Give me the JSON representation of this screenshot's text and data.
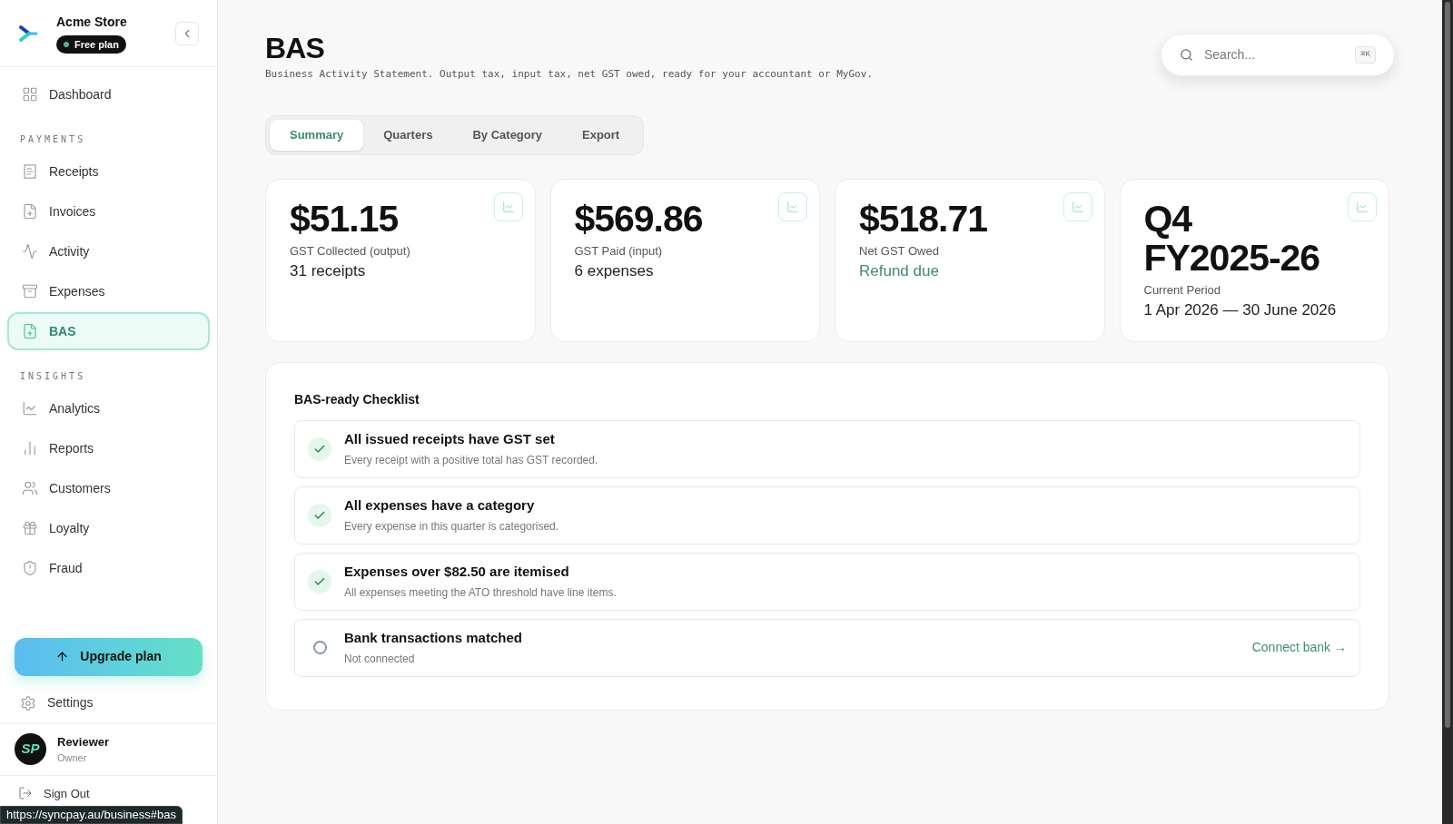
{
  "sidebar": {
    "store_name": "Acme Store",
    "plan_badge": "Free plan",
    "nav": [
      {
        "kind": "item",
        "label": "Dashboard",
        "selected": false
      },
      {
        "kind": "section",
        "label": "PAYMENTS"
      },
      {
        "kind": "item",
        "label": "Receipts",
        "selected": false
      },
      {
        "kind": "item",
        "label": "Invoices",
        "selected": false
      },
      {
        "kind": "item",
        "label": "Activity",
        "selected": false
      },
      {
        "kind": "item",
        "label": "Expenses",
        "selected": false
      },
      {
        "kind": "item",
        "label": "BAS",
        "selected": true
      },
      {
        "kind": "section",
        "label": "INSIGHTS"
      },
      {
        "kind": "item",
        "label": "Analytics",
        "selected": false
      },
      {
        "kind": "item",
        "label": "Reports",
        "selected": false
      },
      {
        "kind": "item",
        "label": "Customers",
        "selected": false
      },
      {
        "kind": "item",
        "label": "Loyalty",
        "selected": false
      },
      {
        "kind": "item",
        "label": "Fraud",
        "selected": false
      }
    ],
    "upgrade_button": "Upgrade plan",
    "settings": "Settings",
    "user": {
      "avatar": "SP",
      "name": "Reviewer",
      "role": "Owner"
    },
    "sign_out": "Sign Out"
  },
  "status_url": "https://syncpay.au/business#bas",
  "header": {
    "title": "BAS",
    "subtitle": "Business Activity Statement. Output tax, input tax, net GST owed, ready for your accountant or MyGov.",
    "search": {
      "placeholder": "Search...",
      "shortcut": "⌘K"
    }
  },
  "tabs": [
    {
      "label": "Summary",
      "selected": true
    },
    {
      "label": "Quarters",
      "selected": false
    },
    {
      "label": "By Category",
      "selected": false
    },
    {
      "label": "Export",
      "selected": false
    }
  ],
  "stats": [
    {
      "value": "$51.15",
      "label": "GST Collected (output)",
      "detail": "31 receipts",
      "kind": "plain"
    },
    {
      "value": "$569.86",
      "label": "GST Paid (input)",
      "detail": "6 expenses",
      "kind": "plain"
    },
    {
      "value": "$518.71",
      "label": "Net GST Owed",
      "detail": "Refund due",
      "kind": "positive"
    },
    {
      "value": "Q4 FY2025-26",
      "label": "Current Period",
      "detail": "1 Apr 2026 — 30 June 2026",
      "kind": "plain"
    }
  ],
  "checklist": {
    "title": "BAS-ready Checklist",
    "items": [
      {
        "title": "All issued receipts have GST set",
        "note": "Every receipt with a positive total has GST recorded.",
        "checked": true
      },
      {
        "title": "All expenses have a category",
        "note": "Every expense in this quarter is categorised.",
        "checked": true
      },
      {
        "title": "Expenses over $82.50 are itemised",
        "note": "All expenses meeting the ATO threshold have line items.",
        "checked": true
      },
      {
        "title": "Bank transactions matched",
        "note": "Not connected",
        "checked": false,
        "action": "Connect bank →"
      }
    ]
  }
}
